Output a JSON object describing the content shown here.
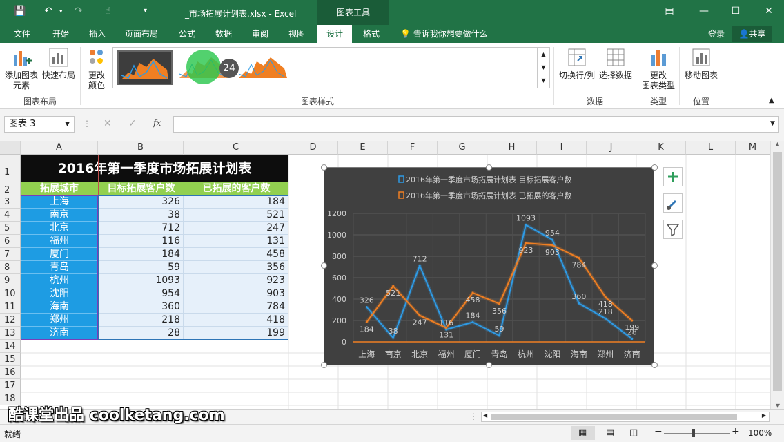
{
  "window": {
    "doc_title": "_市场拓展计划表.xlsx - Excel",
    "context_tools": "图表工具"
  },
  "tabs": [
    {
      "label": "文件"
    },
    {
      "label": "开始"
    },
    {
      "label": "插入"
    },
    {
      "label": "页面布局"
    },
    {
      "label": "公式"
    },
    {
      "label": "数据"
    },
    {
      "label": "审阅"
    },
    {
      "label": "视图"
    },
    {
      "label": "设计"
    },
    {
      "label": "格式"
    }
  ],
  "tellme": "告诉我你想要做什么",
  "login": "登录",
  "share": "共享",
  "ribbon": {
    "add_element": "添加图表",
    "add_element2": "元素",
    "quick_layout": "快速布局",
    "change_color": "更改",
    "change_color2": "颜色",
    "switch_rowcol": "切换行/列",
    "select_data": "选择数据",
    "change_type": "更改",
    "change_type2": "图表类型",
    "move_chart": "移动图表",
    "group_layout": "图表布局",
    "group_styles": "图表样式",
    "group_data": "数据",
    "group_type": "类型",
    "group_location": "位置",
    "badge": "24"
  },
  "formula": {
    "namebox": "图表 3",
    "fx": "fx"
  },
  "columns": [
    "A",
    "B",
    "C",
    "D",
    "E",
    "F",
    "G",
    "H",
    "I",
    "J",
    "K",
    "L",
    "M"
  ],
  "rows": [
    "1",
    "2",
    "3",
    "4",
    "5",
    "6",
    "7",
    "8",
    "9",
    "10",
    "11",
    "12",
    "13",
    "14",
    "15",
    "16",
    "17",
    "18"
  ],
  "sheet": {
    "title": "2016年第一季度市场拓展计划表",
    "header_city": "拓展城市",
    "header_target": "目标拓展客户数",
    "header_done": "已拓展的客户数",
    "data": [
      {
        "city": "上海",
        "target": "326",
        "done": "184"
      },
      {
        "city": "南京",
        "target": "38",
        "done": "521"
      },
      {
        "city": "北京",
        "target": "712",
        "done": "247"
      },
      {
        "city": "福州",
        "target": "116",
        "done": "131"
      },
      {
        "city": "厦门",
        "target": "184",
        "done": "458"
      },
      {
        "city": "青岛",
        "target": "59",
        "done": "356"
      },
      {
        "city": "杭州",
        "target": "1093",
        "done": "923"
      },
      {
        "city": "沈阳",
        "target": "954",
        "done": "903"
      },
      {
        "city": "海南",
        "target": "360",
        "done": "784"
      },
      {
        "city": "郑州",
        "target": "218",
        "done": "418"
      },
      {
        "city": "济南",
        "target": "28",
        "done": "199"
      }
    ]
  },
  "chart_data": {
    "type": "line",
    "categories": [
      "上海",
      "南京",
      "北京",
      "福州",
      "厦门",
      "青岛",
      "杭州",
      "沈阳",
      "海南",
      "郑州",
      "济南"
    ],
    "series": [
      {
        "name": "2016年第一季度市场拓展计划表 目标拓展客户数",
        "values": [
          326,
          38,
          712,
          116,
          184,
          59,
          1093,
          954,
          360,
          218,
          28
        ],
        "color": "#2e9be6"
      },
      {
        "name": "2016年第一季度市场拓展计划表 已拓展的客户数",
        "values": [
          184,
          521,
          247,
          131,
          458,
          356,
          923,
          903,
          784,
          418,
          199
        ],
        "color": "#f07f22"
      }
    ],
    "yticks": [
      "0",
      "200",
      "400",
      "600",
      "800",
      "1000",
      "1200"
    ],
    "ylim": [
      0,
      1200
    ],
    "grid": true,
    "legend": "top"
  },
  "status": {
    "ready": "就绪",
    "zoom": "100%"
  },
  "watermark": "酷课堂出品 coolketang.com"
}
